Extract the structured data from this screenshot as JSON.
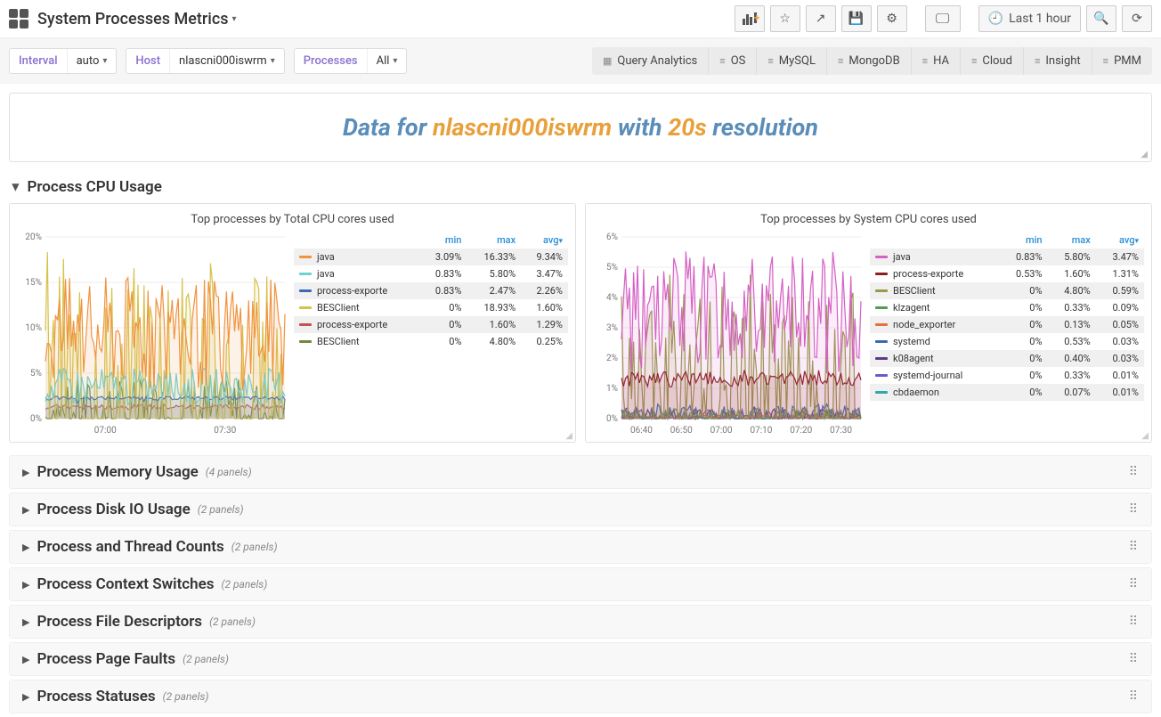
{
  "header": {
    "title": "System Processes Metrics",
    "time_label": "Last 1 hour"
  },
  "filters": {
    "interval": {
      "label": "Interval",
      "value": "auto"
    },
    "host": {
      "label": "Host",
      "value": "nlascni000iswrm"
    },
    "processes": {
      "label": "Processes",
      "value": "All"
    }
  },
  "nav": [
    {
      "label": "Query Analytics",
      "icon": "grid"
    },
    {
      "label": "OS",
      "icon": "menu"
    },
    {
      "label": "MySQL",
      "icon": "menu"
    },
    {
      "label": "MongoDB",
      "icon": "menu"
    },
    {
      "label": "HA",
      "icon": "menu"
    },
    {
      "label": "Cloud",
      "icon": "menu"
    },
    {
      "label": "Insight",
      "icon": "menu"
    },
    {
      "label": "PMM",
      "icon": "menu"
    }
  ],
  "banner": {
    "prefix": "Data for ",
    "host": "nlascni000iswrm",
    "mid": " with ",
    "res": "20s",
    "suffix": " resolution"
  },
  "rows": [
    {
      "title": "Process CPU Usage",
      "open": true
    },
    {
      "title": "Process Memory Usage",
      "count": "(4 panels)"
    },
    {
      "title": "Process Disk IO Usage",
      "count": "(2 panels)"
    },
    {
      "title": "Process and Thread Counts",
      "count": "(2 panels)"
    },
    {
      "title": "Process Context Switches",
      "count": "(2 panels)"
    },
    {
      "title": "Process File Descriptors",
      "count": "(2 panels)"
    },
    {
      "title": "Process Page Faults",
      "count": "(2 panels)"
    },
    {
      "title": "Process Statuses",
      "count": "(2 panels)"
    }
  ],
  "legend_headers": {
    "min": "min",
    "max": "max",
    "avg": "avg"
  },
  "panel_total": {
    "title": "Top processes by Total CPU cores used",
    "legend": [
      {
        "name": "java",
        "color": "#f2933f",
        "min": "3.09%",
        "max": "16.33%",
        "avg": "9.34%"
      },
      {
        "name": "java",
        "color": "#6fd1d1",
        "min": "0.83%",
        "max": "5.80%",
        "avg": "3.47%"
      },
      {
        "name": "process-exporte",
        "color": "#3f68b4",
        "min": "0.83%",
        "max": "2.47%",
        "avg": "2.26%"
      },
      {
        "name": "BESClient",
        "color": "#d6c24a",
        "min": "0%",
        "max": "18.93%",
        "avg": "1.60%"
      },
      {
        "name": "process-exporte",
        "color": "#c65151",
        "min": "0%",
        "max": "1.60%",
        "avg": "1.29%"
      },
      {
        "name": "BESClient",
        "color": "#6e8b3d",
        "min": "0%",
        "max": "4.80%",
        "avg": "0.25%"
      }
    ]
  },
  "panel_system": {
    "title": "Top processes by System CPU cores used",
    "legend": [
      {
        "name": "java",
        "color": "#d661c4",
        "min": "0.83%",
        "max": "5.80%",
        "avg": "3.47%"
      },
      {
        "name": "process-exporte",
        "color": "#8a1f1f",
        "min": "0.53%",
        "max": "1.60%",
        "avg": "1.31%"
      },
      {
        "name": "BESClient",
        "color": "#9a9a4a",
        "min": "0%",
        "max": "4.80%",
        "avg": "0.59%"
      },
      {
        "name": "klzagent",
        "color": "#4f9e4f",
        "min": "0%",
        "max": "0.33%",
        "avg": "0.09%"
      },
      {
        "name": "node_exporter",
        "color": "#e66f3f",
        "min": "0%",
        "max": "0.13%",
        "avg": "0.05%"
      },
      {
        "name": "systemd",
        "color": "#3f68b4",
        "min": "0%",
        "max": "0.53%",
        "avg": "0.03%"
      },
      {
        "name": "k08agent",
        "color": "#5b3b8a",
        "min": "0%",
        "max": "0.40%",
        "avg": "0.03%"
      },
      {
        "name": "systemd-journal",
        "color": "#6a5acd",
        "min": "0%",
        "max": "0.33%",
        "avg": "0.01%"
      },
      {
        "name": "cbdaemon",
        "color": "#2fa8a8",
        "min": "0%",
        "max": "0.07%",
        "avg": "0.01%"
      }
    ]
  },
  "chart_data": [
    {
      "type": "line",
      "title": "Top processes by Total CPU cores used",
      "ylabel": "",
      "xlabel": "",
      "ylim": [
        0,
        20
      ],
      "yticks": [
        "0%",
        "5%",
        "10%",
        "15%",
        "20%"
      ],
      "xticks": [
        "07:00",
        "07:30"
      ],
      "series": [
        {
          "name": "java",
          "color": "#f2933f",
          "min": 3.09,
          "max": 16.33,
          "avg": 9.34
        },
        {
          "name": "java",
          "color": "#6fd1d1",
          "min": 0.83,
          "max": 5.8,
          "avg": 3.47
        },
        {
          "name": "process-exporte",
          "color": "#3f68b4",
          "min": 0.83,
          "max": 2.47,
          "avg": 2.26
        },
        {
          "name": "BESClient",
          "color": "#d6c24a",
          "min": 0.0,
          "max": 18.93,
          "avg": 1.6
        },
        {
          "name": "process-exporte",
          "color": "#c65151",
          "min": 0.0,
          "max": 1.6,
          "avg": 1.29
        },
        {
          "name": "BESClient",
          "color": "#6e8b3d",
          "min": 0.0,
          "max": 4.8,
          "avg": 0.25
        }
      ]
    },
    {
      "type": "line",
      "title": "Top processes by System CPU cores used",
      "ylabel": "",
      "xlabel": "",
      "ylim": [
        0,
        6
      ],
      "yticks": [
        "0%",
        "1%",
        "2%",
        "3%",
        "4%",
        "5%",
        "6%"
      ],
      "xticks": [
        "06:40",
        "06:50",
        "07:00",
        "07:10",
        "07:20",
        "07:30"
      ],
      "series": [
        {
          "name": "java",
          "color": "#d661c4",
          "min": 0.83,
          "max": 5.8,
          "avg": 3.47
        },
        {
          "name": "process-exporte",
          "color": "#8a1f1f",
          "min": 0.53,
          "max": 1.6,
          "avg": 1.31
        },
        {
          "name": "BESClient",
          "color": "#9a9a4a",
          "min": 0.0,
          "max": 4.8,
          "avg": 0.59
        },
        {
          "name": "klzagent",
          "color": "#4f9e4f",
          "min": 0.0,
          "max": 0.33,
          "avg": 0.09
        },
        {
          "name": "node_exporter",
          "color": "#e66f3f",
          "min": 0.0,
          "max": 0.13,
          "avg": 0.05
        },
        {
          "name": "systemd",
          "color": "#3f68b4",
          "min": 0.0,
          "max": 0.53,
          "avg": 0.03
        },
        {
          "name": "k08agent",
          "color": "#5b3b8a",
          "min": 0.0,
          "max": 0.4,
          "avg": 0.03
        },
        {
          "name": "systemd-journal",
          "color": "#6a5acd",
          "min": 0.0,
          "max": 0.33,
          "avg": 0.01
        },
        {
          "name": "cbdaemon",
          "color": "#2fa8a8",
          "min": 0.0,
          "max": 0.07,
          "avg": 0.01
        }
      ]
    }
  ]
}
